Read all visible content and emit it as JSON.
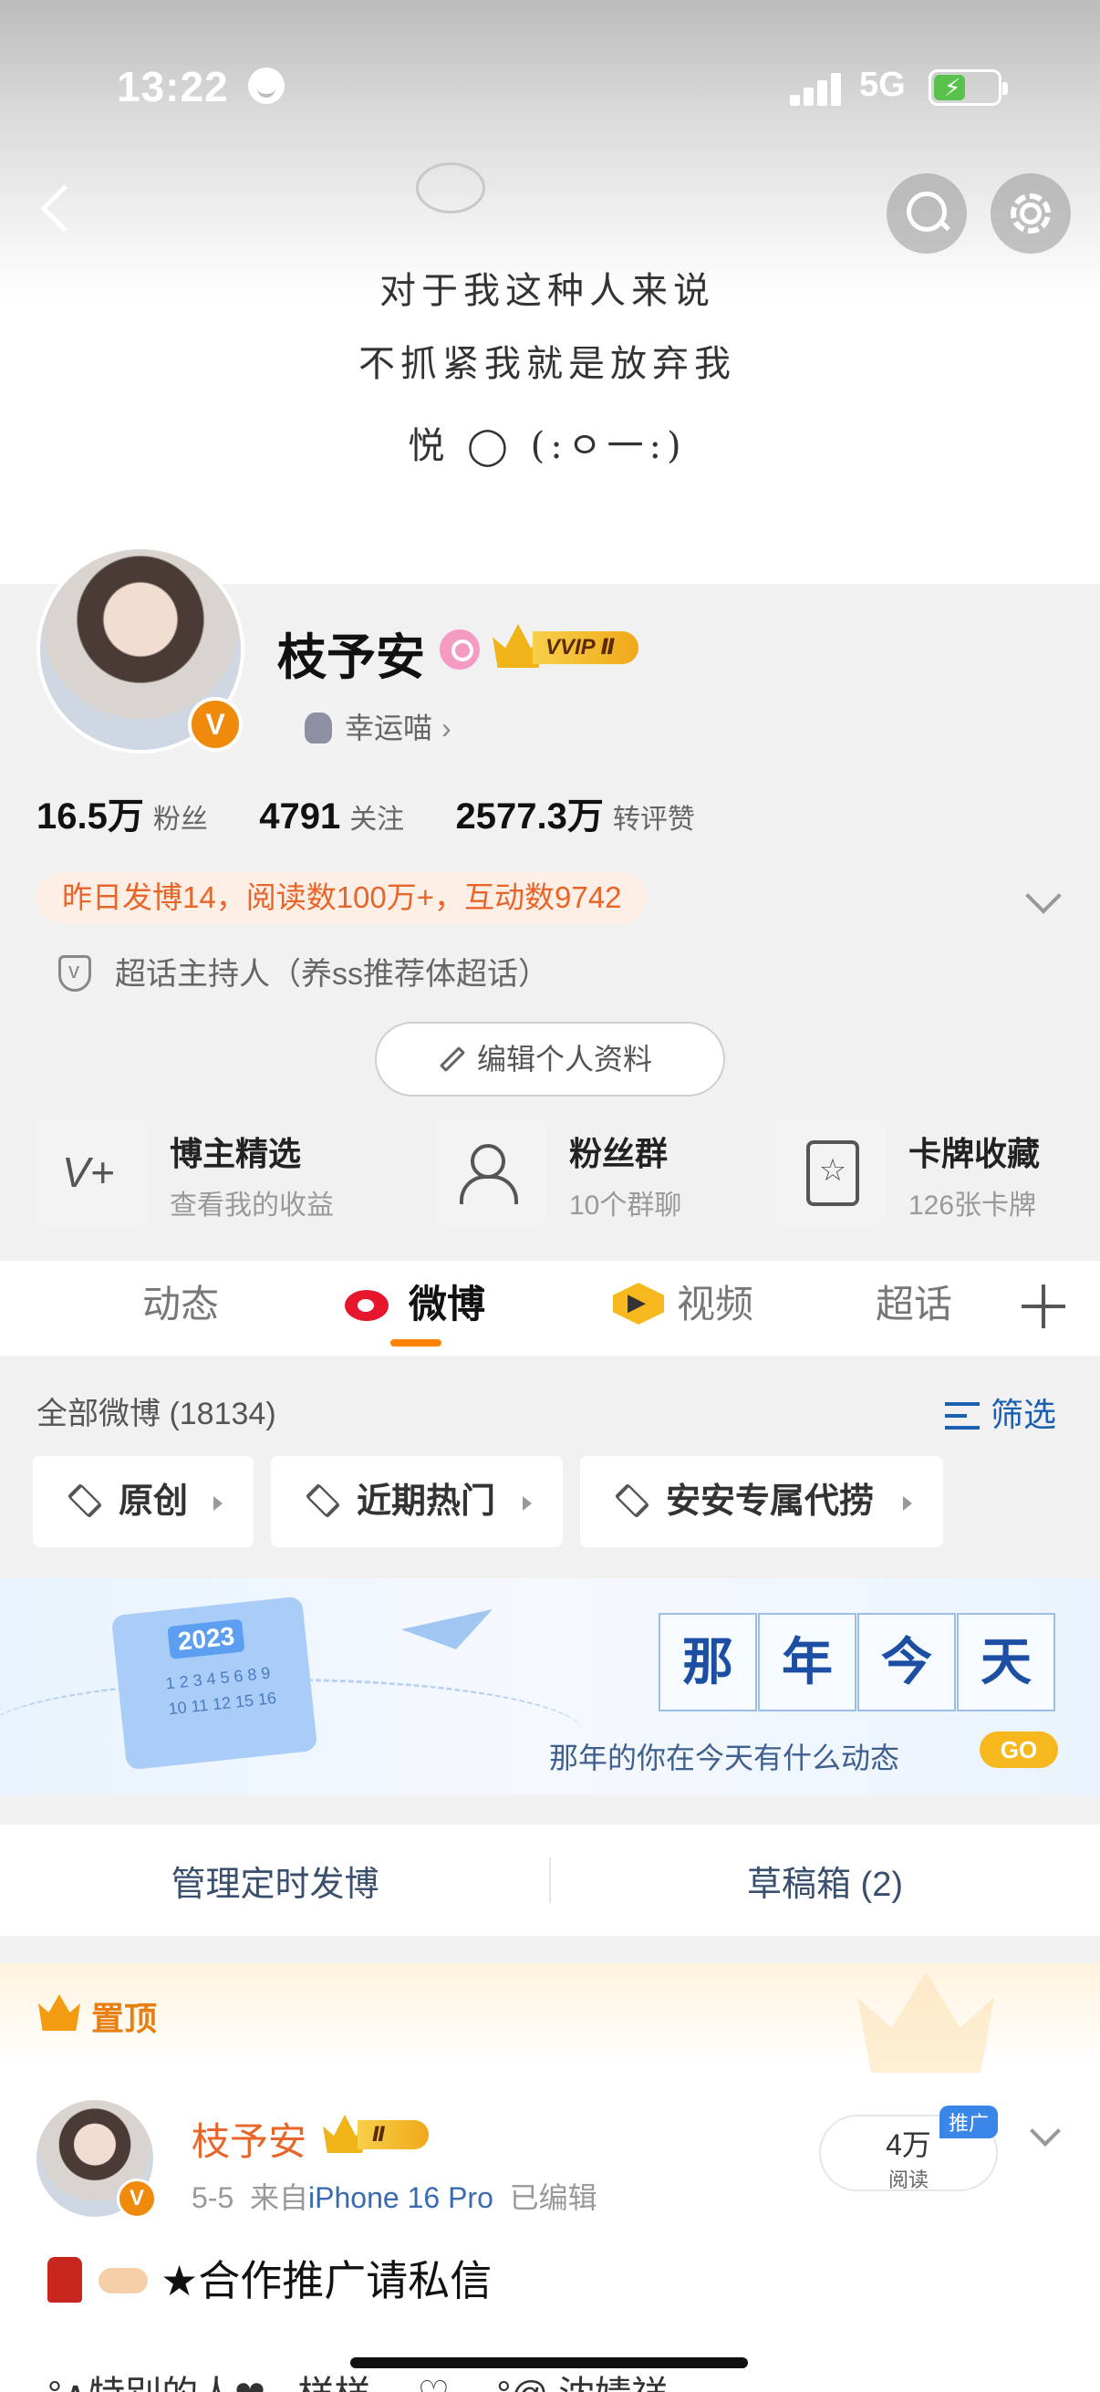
{
  "status_bar": {
    "time": "13:22",
    "network": "5G"
  },
  "cover": {
    "lines": [
      "对于我这种人来说",
      "不抓紧我就是放弃我",
      "悦 ◯ (:ㅇ一:)"
    ]
  },
  "profile": {
    "name": "枝予安",
    "vip_label": "VVIP Ⅱ",
    "lucky_label": "幸运喵",
    "stats": [
      {
        "value": "16.5万",
        "label": "粉丝"
      },
      {
        "value": "4791",
        "label": "关注"
      },
      {
        "value": "2577.3万",
        "label": "转评赞"
      }
    ],
    "yesterday": "昨日发博14，阅读数100万+，互动数9742",
    "host": "超话主持人（养ss推荐体超话）",
    "edit_label": "编辑个人资料"
  },
  "features": [
    {
      "title": "博主精选",
      "subtitle": "查看我的收益"
    },
    {
      "title": "粉丝群",
      "subtitle": "10个群聊"
    },
    {
      "title": "卡牌收藏",
      "subtitle": "126张卡牌"
    }
  ],
  "tabs": [
    {
      "label": "动态"
    },
    {
      "label": "微博"
    },
    {
      "label": "视频"
    },
    {
      "label": "超话"
    }
  ],
  "feed": {
    "all_count": "全部微博 (18134)",
    "filter_label": "筛选",
    "chips": [
      "原创",
      "近期热门",
      "安安专属代捞"
    ]
  },
  "banner": {
    "year": "2023",
    "grid": "1 2 3 4 5 6 8 9 10 11 12 15 16",
    "chars": [
      "那",
      "年",
      "今",
      "天"
    ],
    "subtitle": "那年的你在今天有什么动态",
    "go": "GO"
  },
  "manage": {
    "scheduled": "管理定时发博",
    "drafts": "草稿箱 (2)"
  },
  "pinned_post": {
    "pin_label": "置顶",
    "author": "枝予安",
    "vip_label": "Ⅱ",
    "verified": "V",
    "date": "5-5",
    "from": "来自",
    "device": "iPhone 16 Pro",
    "edited": "已编辑",
    "reads_value": "4万",
    "reads_label": "阅读",
    "promo": "推广",
    "text": "★合作推广请私信",
    "next_line": "°∧特别的人❤ · 样样 ⸝⸝♡⸝⸝ °@ 沈婧祥"
  },
  "colors": {
    "accent_orange": "#ff8200",
    "link_blue": "#1b5fb0",
    "name_orange": "#e8652a"
  },
  "icons": [
    "back-icon",
    "search-icon",
    "gear-icon",
    "weibo-icon",
    "video-icon",
    "plus-icon",
    "filter-icon",
    "layers-icon",
    "crown-icon",
    "pencil-icon",
    "shield-icon",
    "cat-icon"
  ]
}
